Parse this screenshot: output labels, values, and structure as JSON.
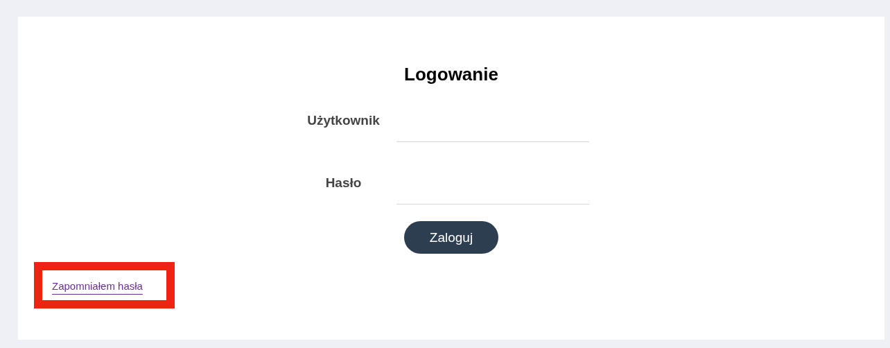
{
  "title": "Logowanie",
  "fields": [
    {
      "label": "Użytkownik"
    },
    {
      "label": "Hasło"
    }
  ],
  "submit": "Zaloguj",
  "forgot_link": {
    "label": "Zapomniałem hasła",
    "highlighted": true
  }
}
